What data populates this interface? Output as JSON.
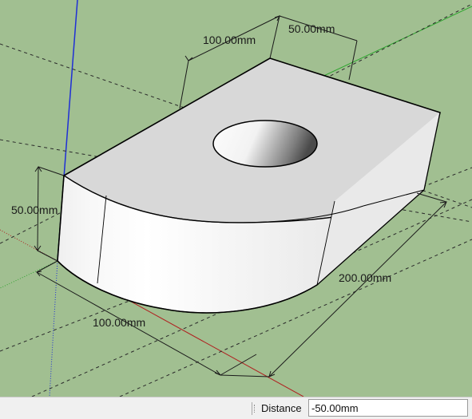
{
  "model": {
    "dimensions": {
      "top_width": "100.00mm",
      "top_depth": "50.00mm",
      "height": "50.00mm",
      "front_width": "100.00mm",
      "length": "200.00mm"
    }
  },
  "status_bar": {
    "measurements_label": "Distance",
    "measurements_value": "-50.00mm"
  },
  "colors": {
    "background": "#a1bf91",
    "blue_axis": "#1f2fd6",
    "green_axis": "#2fa52f",
    "red_axis": "#b02020",
    "face_top": "#d8d8d8",
    "face_side": "#e8e8e8"
  }
}
